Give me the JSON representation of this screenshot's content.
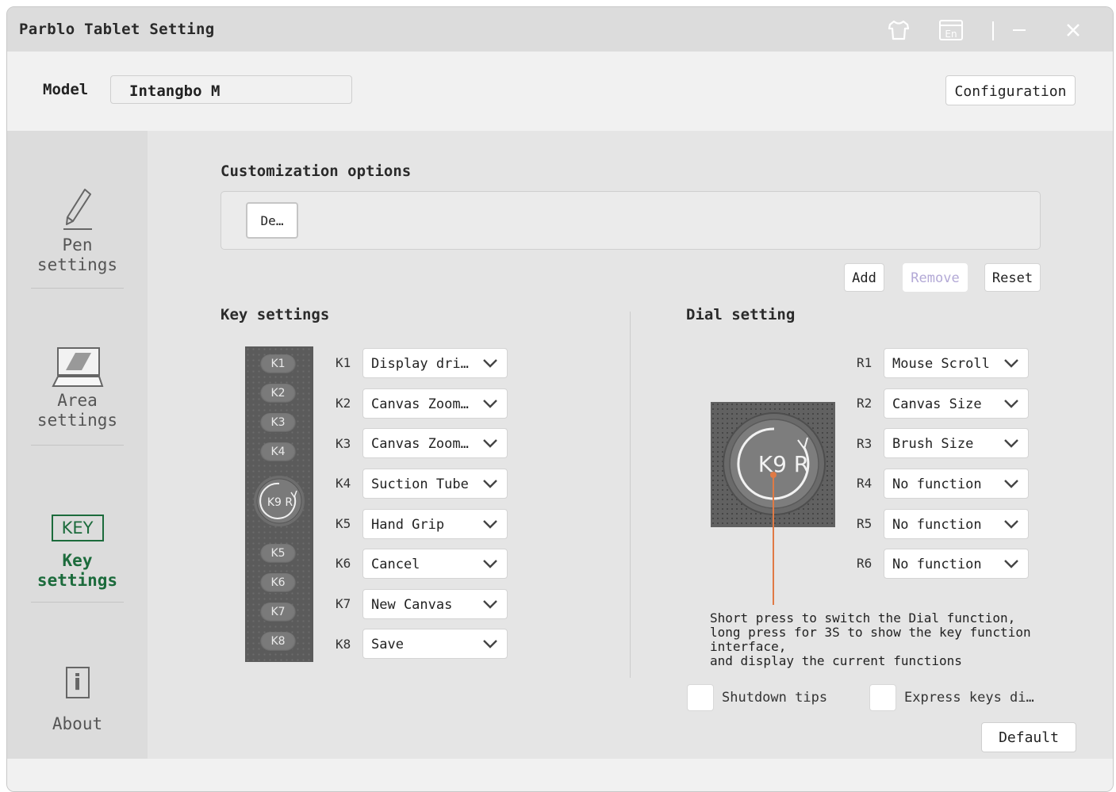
{
  "window": {
    "title": "Parblo Tablet Setting",
    "titlebar_buttons": [
      "skin-icon",
      "language-icon",
      "minimize-icon",
      "close-icon"
    ],
    "language_badge": "En"
  },
  "model": {
    "label": "Model",
    "value": "Intangbo M",
    "configuration": "Configuration"
  },
  "sidebar": {
    "items": [
      {
        "label": "Pen\nsettings",
        "icon": "pen-icon",
        "active": false
      },
      {
        "label": "Area\nsettings",
        "icon": "laptop-icon",
        "active": false
      },
      {
        "label": "Key\nsettings",
        "icon": "key-icon",
        "icon_text": "KEY",
        "active": true
      },
      {
        "label": "About",
        "icon": "info-icon",
        "icon_text": "i",
        "active": false
      }
    ]
  },
  "customization": {
    "title": "Customization options",
    "chip": "De…",
    "buttons": {
      "add": "Add",
      "remove": "Remove",
      "reset": "Reset"
    }
  },
  "key_settings": {
    "title": "Key settings",
    "tablet_buttons": [
      "K1",
      "K2",
      "K3",
      "K4",
      "K5",
      "K6",
      "K7",
      "K8"
    ],
    "dial_label": "K9 R",
    "rows": [
      {
        "key": "K1",
        "value": "Display dri…"
      },
      {
        "key": "K2",
        "value": "Canvas Zoom…"
      },
      {
        "key": "K3",
        "value": "Canvas Zoom…"
      },
      {
        "key": "K4",
        "value": "Suction Tube"
      },
      {
        "key": "K5",
        "value": "Hand Grip"
      },
      {
        "key": "K6",
        "value": "Cancel"
      },
      {
        "key": "K7",
        "value": "New Canvas"
      },
      {
        "key": "K8",
        "value": "Save"
      }
    ]
  },
  "dial_setting": {
    "title": "Dial setting",
    "dial_label": "K9 R",
    "rows": [
      {
        "key": "R1",
        "value": "Mouse Scroll"
      },
      {
        "key": "R2",
        "value": "Canvas Size"
      },
      {
        "key": "R3",
        "value": "Brush Size"
      },
      {
        "key": "R4",
        "value": "No function"
      },
      {
        "key": "R5",
        "value": "No function"
      },
      {
        "key": "R6",
        "value": "No function"
      }
    ],
    "note_lines": [
      "Short press to switch the Dial function,",
      "long press for 3S to show the key function",
      "interface,",
      "and display the current functions"
    ]
  },
  "options": {
    "shutdown_tips": "Shutdown tips",
    "express_keys": "Express keys di…",
    "default_button": "Default"
  },
  "colors": {
    "accent_green": "#1c6b3c",
    "dial_pointer": "#e07a45",
    "remove_disabled": "#b3a9d6"
  }
}
